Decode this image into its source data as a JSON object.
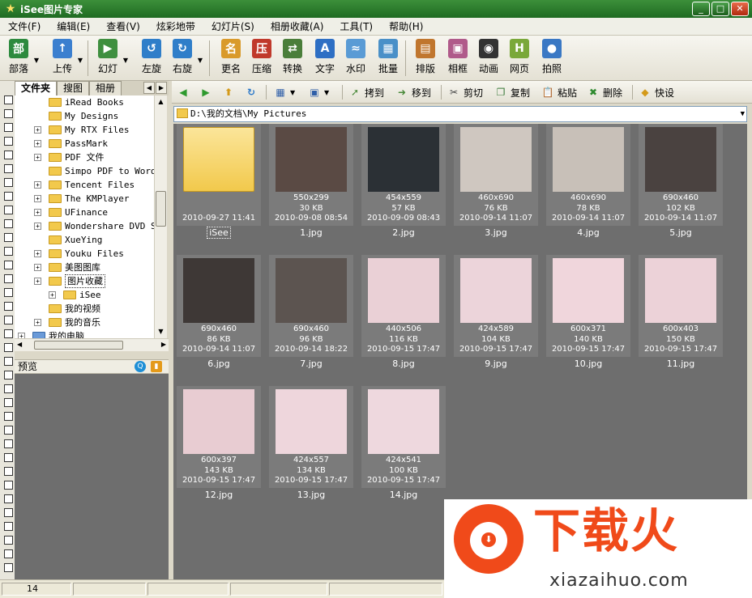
{
  "window": {
    "title": "iSee图片专家",
    "buttons": [
      "minimize",
      "maximize",
      "close"
    ]
  },
  "menu": [
    "文件(F)",
    "编辑(E)",
    "查看(V)",
    "炫彩地带",
    "幻灯片(S)",
    "相册收藏(A)",
    "工具(T)",
    "帮助(H)"
  ],
  "toolbar": {
    "buttons": [
      {
        "label": "部落",
        "icon": "tribe-icon",
        "color": "#2d8a3e",
        "glyph": "部"
      },
      {
        "label": "上传",
        "icon": "upload-icon",
        "color": "#3b7fcf",
        "glyph": "↑"
      },
      {
        "label": "幻灯",
        "icon": "slideshow-icon",
        "color": "#3f8f3f",
        "glyph": "▶"
      },
      {
        "label": "左旋",
        "icon": "rotate-left-icon",
        "color": "#2f7ec9",
        "glyph": "↺"
      },
      {
        "label": "右旋",
        "icon": "rotate-right-icon",
        "color": "#2f7ec9",
        "glyph": "↻"
      },
      {
        "label": "更名",
        "icon": "rename-icon",
        "color": "#d99a2b",
        "glyph": "名"
      },
      {
        "label": "压缩",
        "icon": "compress-icon",
        "color": "#c0392b",
        "glyph": "压"
      },
      {
        "label": "转换",
        "icon": "convert-icon",
        "color": "#4a7e3a",
        "glyph": "⇄"
      },
      {
        "label": "文字",
        "icon": "text-icon",
        "color": "#2e6fc4",
        "glyph": "A"
      },
      {
        "label": "水印",
        "icon": "watermark-icon",
        "color": "#5a9bd5",
        "glyph": "≈"
      },
      {
        "label": "批量",
        "icon": "batch-icon",
        "color": "#4a90c8",
        "glyph": "▦"
      },
      {
        "label": "排版",
        "icon": "layout-icon",
        "color": "#c0762e",
        "glyph": "▤"
      },
      {
        "label": "相框",
        "icon": "frame-icon",
        "color": "#b05a8a",
        "glyph": "▣"
      },
      {
        "label": "动画",
        "icon": "animation-icon",
        "color": "#333333",
        "glyph": "◉"
      },
      {
        "label": "网页",
        "icon": "webpage-icon",
        "color": "#7aa83a",
        "glyph": "H"
      },
      {
        "label": "拍照",
        "icon": "webcam-icon",
        "color": "#3a78c4",
        "glyph": "●"
      }
    ]
  },
  "left_panel": {
    "tabs": [
      "文件夹",
      "搜图",
      "相册"
    ],
    "tree": [
      {
        "label": "iRead Books",
        "expander": false
      },
      {
        "label": "My Designs",
        "expander": false
      },
      {
        "label": "My RTX Files",
        "expander": true
      },
      {
        "label": "PassMark",
        "expander": true
      },
      {
        "label": "PDF 文件",
        "expander": true
      },
      {
        "label": "Simpo PDF to Word",
        "expander": false
      },
      {
        "label": "Tencent Files",
        "expander": true
      },
      {
        "label": "The KMPlayer",
        "expander": true
      },
      {
        "label": "UFinance",
        "expander": true
      },
      {
        "label": "Wondershare DVD Sl",
        "expander": true
      },
      {
        "label": "XueYing",
        "expander": false
      },
      {
        "label": "Youku Files",
        "expander": true
      },
      {
        "label": "美图图库",
        "expander": true
      },
      {
        "label": "图片收藏",
        "expander": true,
        "selected": true
      },
      {
        "label": "iSee",
        "expander": true,
        "child": true
      },
      {
        "label": "我的视频",
        "expander": false
      },
      {
        "label": "我的音乐",
        "expander": true
      },
      {
        "label": "我的电脑",
        "expander": true,
        "root": true
      }
    ],
    "preview_label": "预览"
  },
  "toolbar2": {
    "buttons": [
      {
        "label": "拷到",
        "icon": "copy-to-icon"
      },
      {
        "label": "移到",
        "icon": "move-to-icon"
      },
      {
        "label": "剪切",
        "icon": "cut-icon"
      },
      {
        "label": "复制",
        "icon": "copy-icon"
      },
      {
        "label": "粘贴",
        "icon": "paste-icon"
      },
      {
        "label": "删除",
        "icon": "delete-icon"
      },
      {
        "label": "快设",
        "icon": "quick-settings-icon"
      }
    ]
  },
  "address": "D:\\我的文档\\My Pictures",
  "thumbnails": [
    {
      "name": "iSee",
      "dims": "",
      "size": "",
      "date": "2010-09-27 11:41",
      "folder": true,
      "color": "#f2c94c",
      "selected": true
    },
    {
      "name": "1.jpg",
      "dims": "550x299",
      "size": "30 KB",
      "date": "2010-09-08 08:54",
      "color": "#5a4a44"
    },
    {
      "name": "2.jpg",
      "dims": "454x559",
      "size": "57 KB",
      "date": "2010-09-09 08:43",
      "color": "#2b3035"
    },
    {
      "name": "3.jpg",
      "dims": "460x690",
      "size": "76 KB",
      "date": "2010-09-14 11:07",
      "color": "#cfc7c0"
    },
    {
      "name": "4.jpg",
      "dims": "460x690",
      "size": "78 KB",
      "date": "2010-09-14 11:07",
      "color": "#c8c0b8"
    },
    {
      "name": "5.jpg",
      "dims": "690x460",
      "size": "102 KB",
      "date": "2010-09-14 11:07",
      "color": "#4a4240"
    },
    {
      "name": "6.jpg",
      "dims": "690x460",
      "size": "86 KB",
      "date": "2010-09-14 11:07",
      "color": "#3e3836"
    },
    {
      "name": "7.jpg",
      "dims": "690x460",
      "size": "96 KB",
      "date": "2010-09-14 18:22",
      "color": "#5c5450"
    },
    {
      "name": "8.jpg",
      "dims": "440x506",
      "size": "116 KB",
      "date": "2010-09-15 17:47",
      "color": "#ead0d6"
    },
    {
      "name": "9.jpg",
      "dims": "424x589",
      "size": "104 KB",
      "date": "2010-09-15 17:47",
      "color": "#ecd4da"
    },
    {
      "name": "10.jpg",
      "dims": "600x371",
      "size": "140 KB",
      "date": "2010-09-15 17:47",
      "color": "#f0d6dc"
    },
    {
      "name": "11.jpg",
      "dims": "600x403",
      "size": "150 KB",
      "date": "2010-09-15 17:47",
      "color": "#ecd2d8"
    },
    {
      "name": "12.jpg",
      "dims": "600x397",
      "size": "143 KB",
      "date": "2010-09-15 17:47",
      "color": "#e8ccd2"
    },
    {
      "name": "13.jpg",
      "dims": "424x557",
      "size": "134 KB",
      "date": "2010-09-15 17:47",
      "color": "#eed6dc"
    },
    {
      "name": "14.jpg",
      "dims": "424x541",
      "size": "100 KB",
      "date": "2010-09-15 17:47",
      "color": "#eed8de"
    }
  ],
  "status": {
    "count": "14"
  },
  "watermark": {
    "title": "下载火",
    "url": "xiazaihuo.com"
  }
}
